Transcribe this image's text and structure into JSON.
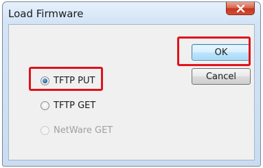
{
  "window": {
    "title": "Load Firmware"
  },
  "buttons": {
    "ok_label": "OK",
    "cancel_label": "Cancel"
  },
  "options": [
    {
      "label": "TFTP PUT",
      "checked": true,
      "enabled": true
    },
    {
      "label": "TFTP GET",
      "checked": false,
      "enabled": true
    },
    {
      "label": "NetWare GET",
      "checked": false,
      "enabled": false
    }
  ],
  "colors": {
    "highlight": "#e0121b",
    "close_button": "#c6351c",
    "default_button_border": "#3c7fb1",
    "radio_selected": "#2d6ea8"
  },
  "icons": {
    "close": "close-icon"
  }
}
